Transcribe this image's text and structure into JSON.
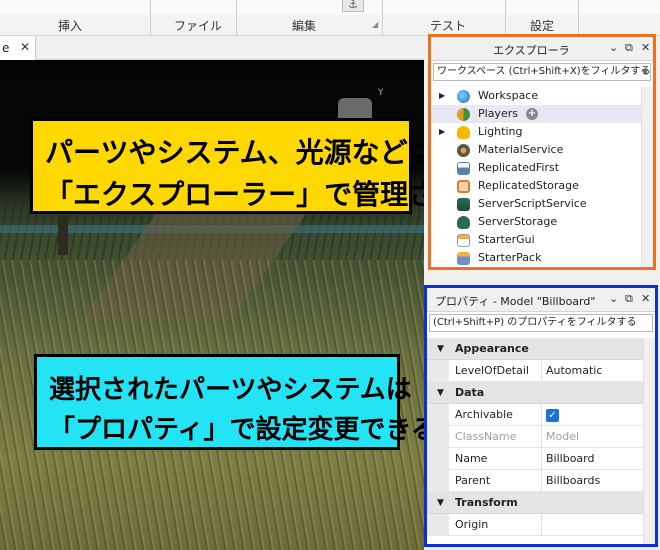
{
  "ribbon": {
    "groups": [
      "挿入",
      "ファイル",
      "編集",
      "テスト",
      "設定"
    ],
    "anchor_icon": "anchor-icon"
  },
  "tab": {
    "label": "e",
    "close": "✕"
  },
  "viewport": {
    "axis_label": "Y"
  },
  "callouts": {
    "top": {
      "line1": "パーツやシステム、光源などは",
      "line2": "「エクスプローラー」で管理される",
      "color": "#ffd800"
    },
    "bottom": {
      "line1": "選択されたパーツやシステムは",
      "line2": "「プロパティ」で設定変更できる",
      "color": "#22e4f4"
    }
  },
  "explorer": {
    "title": "エクスプローラ",
    "filter_placeholder": "ワークスペース (Ctrl+Shift+X)をフィルタする",
    "highlight_color": "#f07020",
    "items": [
      {
        "label": "Workspace",
        "icon": "globe-icon",
        "expandable": true
      },
      {
        "label": "Players",
        "icon": "players-icon",
        "expandable": false,
        "selected": true,
        "add": "+"
      },
      {
        "label": "Lighting",
        "icon": "lightbulb-icon",
        "expandable": true
      },
      {
        "label": "MaterialService",
        "icon": "material-service-icon",
        "expandable": false
      },
      {
        "label": "ReplicatedFirst",
        "icon": "replicated-first-icon",
        "expandable": false
      },
      {
        "label": "ReplicatedStorage",
        "icon": "replicated-storage-icon",
        "expandable": false
      },
      {
        "label": "ServerScriptService",
        "icon": "server-script-service-icon",
        "expandable": false
      },
      {
        "label": "ServerStorage",
        "icon": "server-storage-icon",
        "expandable": false
      },
      {
        "label": "StarterGui",
        "icon": "starter-gui-icon",
        "expandable": false
      },
      {
        "label": "StarterPack",
        "icon": "starter-pack-icon",
        "expandable": false
      }
    ]
  },
  "properties": {
    "title": "プロパティ - Model \"Billboard\"",
    "filter_placeholder": "(Ctrl+Shift+P) のプロパティをフィルタする",
    "highlight_color": "#0a2ee0",
    "rows": [
      {
        "type": "section",
        "label": "Appearance"
      },
      {
        "type": "prop",
        "name": "LevelOfDetail",
        "value": "Automatic"
      },
      {
        "type": "section",
        "label": "Data"
      },
      {
        "type": "prop",
        "name": "Archivable",
        "value": "",
        "checkbox": true
      },
      {
        "type": "prop",
        "name": "ClassName",
        "value": "Model",
        "dim": true
      },
      {
        "type": "prop",
        "name": "Name",
        "value": "Billboard"
      },
      {
        "type": "prop",
        "name": "Parent",
        "value": "Billboards"
      },
      {
        "type": "section",
        "label": "Transform"
      },
      {
        "type": "prop",
        "name": "Origin",
        "value": ""
      }
    ]
  }
}
